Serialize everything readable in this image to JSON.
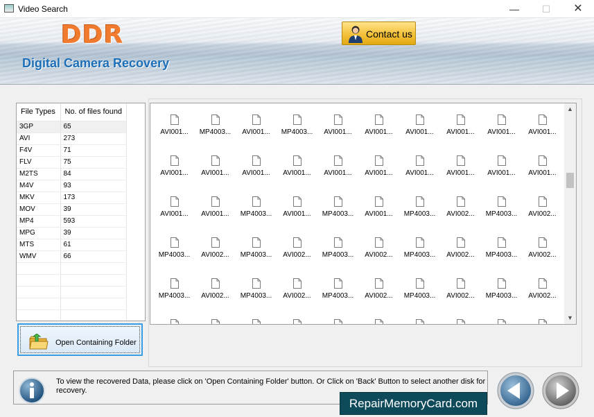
{
  "window": {
    "title": "Video Search",
    "minimize": "—",
    "maximize": "☐",
    "close": "✕"
  },
  "banner": {
    "logo": "DDR",
    "subtitle": "Digital Camera Recovery",
    "contact_label": "Contact us"
  },
  "file_types_table": {
    "headers": [
      "File Types",
      "No. of files found"
    ],
    "rows": [
      [
        "3GP",
        "65"
      ],
      [
        "AVI",
        "273"
      ],
      [
        "F4V",
        "71"
      ],
      [
        "FLV",
        "75"
      ],
      [
        "M2TS",
        "84"
      ],
      [
        "M4V",
        "93"
      ],
      [
        "MKV",
        "173"
      ],
      [
        "MOV",
        "39"
      ],
      [
        "MP4",
        "593"
      ],
      [
        "MPG",
        "39"
      ],
      [
        "MTS",
        "61"
      ],
      [
        "WMV",
        "66"
      ]
    ],
    "selected_row": 0
  },
  "open_folder_button": {
    "label": "Open Containing Folder"
  },
  "file_grid": {
    "rows": [
      [
        "AVI001...",
        "MP4003...",
        "AVI001...",
        "MP4003...",
        "AVI001...",
        "AVI001...",
        "AVI001...",
        "AVI001...",
        "AVI001...",
        "AVI001..."
      ],
      [
        "AVI001...",
        "AVI001...",
        "AVI001...",
        "AVI001...",
        "AVI001...",
        "AVI001...",
        "AVI001...",
        "AVI001...",
        "AVI001...",
        "AVI001..."
      ],
      [
        "AVI001...",
        "AVI001...",
        "MP4003...",
        "AVI001...",
        "MP4003...",
        "AVI001...",
        "MP4003...",
        "AVI002...",
        "MP4003...",
        "AVI002..."
      ],
      [
        "MP4003...",
        "AVI002...",
        "MP4003...",
        "AVI002...",
        "MP4003...",
        "AVI002...",
        "MP4003...",
        "AVI002...",
        "MP4003...",
        "AVI002..."
      ],
      [
        "MP4003...",
        "AVI002...",
        "MP4003...",
        "AVI002...",
        "MP4003...",
        "AVI002...",
        "MP4003...",
        "AVI002...",
        "MP4003...",
        "AVI002..."
      ],
      [
        "",
        "",
        "",
        "",
        "",
        "",
        "",
        "",
        "",
        ""
      ]
    ]
  },
  "info_bar": {
    "text": "To view the recovered Data, please click on 'Open Containing Folder' button. Or Click on 'Back' Button to select another disk for recovery."
  },
  "brand_badge": "RepairMemoryCard.com",
  "icons": [
    "app-icon",
    "contact-person-icon",
    "folder-icon",
    "file-icon",
    "info-icon",
    "back-arrow-icon",
    "next-arrow-icon",
    "scroll-up-icon",
    "scroll-down-icon"
  ],
  "colors": {
    "logo": "#f07a2e",
    "subtitle": "#1d6fb8",
    "contact_button": "#f5c440",
    "badge": "#0f4a5b",
    "selection_border": "#3a9de4"
  }
}
